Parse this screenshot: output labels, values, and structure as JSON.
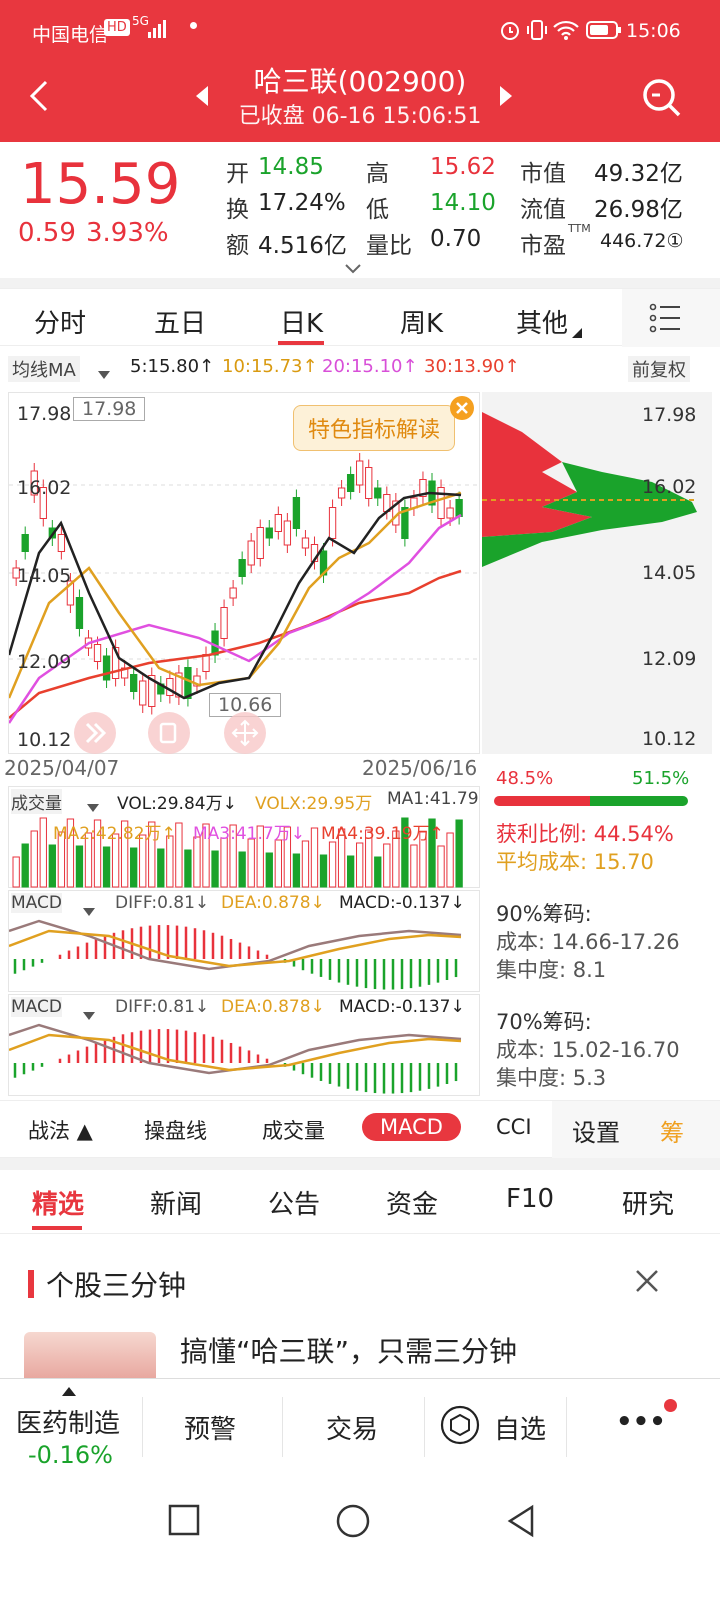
{
  "status": {
    "carrier": "中国电信",
    "hd": "HD",
    "net": "5G",
    "time": "15:06"
  },
  "header": {
    "title": "哈三联(002900)",
    "subtitle": "已收盘  06-16 15:06:51"
  },
  "quote": {
    "price": "15.59",
    "change": "0.59",
    "pct": "3.93%",
    "open_lbl": "开",
    "open": "14.85",
    "high_lbl": "高",
    "high": "15.62",
    "mcap_lbl": "市值",
    "mcap": "49.32亿",
    "turn_lbl": "换",
    "turn": "17.24%",
    "low_lbl": "低",
    "low": "14.10",
    "float_lbl": "流值",
    "float": "26.98亿",
    "amt_lbl": "额",
    "amt": "4.516亿",
    "vr_lbl": "量比",
    "vr": "0.70",
    "pe_lbl": "市盈",
    "pe_sup": "TTM",
    "pe": "446.72①"
  },
  "tabs": [
    "分时",
    "五日",
    "日K",
    "周K",
    "其他"
  ],
  "ma": {
    "label": "均线MA",
    "ma5": "5:15.80↑",
    "ma10": "10:15.73↑",
    "ma20": "20:15.10↑",
    "ma30": "30:13.90↑",
    "adjust": "前复权"
  },
  "chart": {
    "max_label": "17.98",
    "min_label": "10.66",
    "promo": "特色指标解读",
    "date_start": "2025/04/07",
    "date_end": "2025/06/16",
    "left_ticks": [
      "17.98",
      "16.02",
      "14.05",
      "12.09",
      "10.12"
    ],
    "right_ticks": [
      "17.98",
      "16.02",
      "14.05",
      "12.09",
      "10.12"
    ]
  },
  "chips": {
    "loss_pct": "48.5%",
    "profit_pct": "51.5%",
    "profit_ratio": "获利比例: 44.54%",
    "avg_cost": "平均成本: 15.70",
    "c90_title": "90%筹码:",
    "c90_cost": "成本: 14.66-17.26",
    "c90_conc": "集中度: 8.1",
    "c70_title": "70%筹码:",
    "c70_cost": "成本: 15.02-16.70",
    "c70_conc": "集中度: 5.3"
  },
  "vol": {
    "label": "成交量",
    "vol": "VOL:29.84万↓",
    "volx": "VOLX:29.95万",
    "ma1": "MA1:41.79",
    "ma2": "MA2:42.82万↑",
    "ma3": "MA3:41.7万↓",
    "ma4": "MA4:39.19万↑"
  },
  "macd": {
    "label": "MACD",
    "diff": "DIFF:0.81↓",
    "dea": "DEA:0.878↓",
    "macd": "MACD:-0.137↓"
  },
  "tools": [
    "战法 ▲",
    "操盘线",
    "成交量",
    "MACD",
    "CCI",
    "设置",
    "筹"
  ],
  "news_tabs": [
    "精选",
    "新闻",
    "公告",
    "资金",
    "F10",
    "研究"
  ],
  "news": {
    "section": "个股三分钟",
    "headline": "搞懂“哈三联”，只需三分钟"
  },
  "bottom": {
    "sector": "医药制造",
    "sector_pct": "-0.16%",
    "alert": "预警",
    "trade": "交易",
    "watch": "自选",
    "more": "•••"
  },
  "chart_data": {
    "type": "candlestick",
    "x_range": [
      "2025/04/07",
      "2025/06/16"
    ],
    "ylim": [
      10.12,
      17.98
    ],
    "ma_lines": [
      {
        "name": "MA5",
        "value": 15.8,
        "color": "#222222"
      },
      {
        "name": "MA10",
        "value": 15.73,
        "color": "#e0a020"
      },
      {
        "name": "MA20",
        "value": 15.1,
        "color": "#e050e0"
      },
      {
        "name": "MA30",
        "value": 13.9,
        "color": "#e8402e"
      }
    ],
    "last_close": 15.59,
    "max": 17.98,
    "min": 10.66
  }
}
